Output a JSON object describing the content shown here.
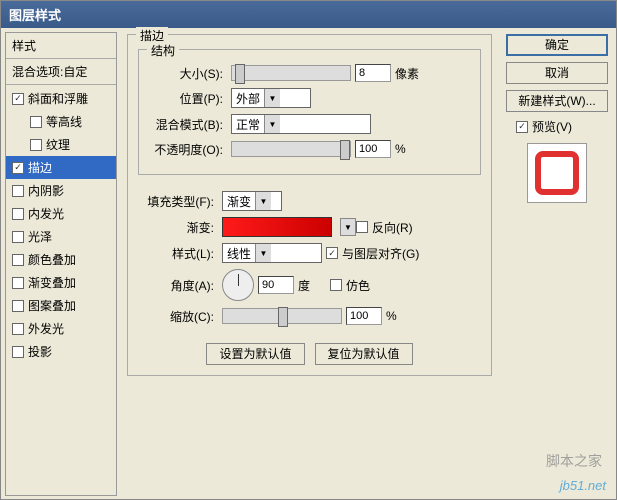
{
  "dialog": {
    "title": "图层样式"
  },
  "sidebar": {
    "header": "样式",
    "blendOptions": "混合选项:自定",
    "items": [
      {
        "label": "斜面和浮雕",
        "checked": true,
        "indent": false
      },
      {
        "label": "等高线",
        "checked": false,
        "indent": true
      },
      {
        "label": "纹理",
        "checked": false,
        "indent": true
      },
      {
        "label": "描边",
        "checked": true,
        "indent": false,
        "active": true
      },
      {
        "label": "内阴影",
        "checked": false,
        "indent": false
      },
      {
        "label": "内发光",
        "checked": false,
        "indent": false
      },
      {
        "label": "光泽",
        "checked": false,
        "indent": false
      },
      {
        "label": "颜色叠加",
        "checked": false,
        "indent": false
      },
      {
        "label": "渐变叠加",
        "checked": false,
        "indent": false
      },
      {
        "label": "图案叠加",
        "checked": false,
        "indent": false
      },
      {
        "label": "外发光",
        "checked": false,
        "indent": false
      },
      {
        "label": "投影",
        "checked": false,
        "indent": false
      }
    ]
  },
  "main": {
    "panelTitle": "描边",
    "structure": {
      "legend": "结构",
      "sizeLabel": "大小(S):",
      "sizeValue": "8",
      "sizeUnit": "像素",
      "positionLabel": "位置(P):",
      "positionValue": "外部",
      "blendModeLabel": "混合模式(B):",
      "blendModeValue": "正常",
      "opacityLabel": "不透明度(O):",
      "opacityValue": "100",
      "opacityUnit": "%"
    },
    "fill": {
      "fillTypeLabel": "填充类型(F):",
      "fillTypeValue": "渐变",
      "gradientLabel": "渐变:",
      "reverseLabel": "反向(R)",
      "styleLabel": "样式(L):",
      "styleValue": "线性",
      "alignLabel": "与图层对齐(G)",
      "angleLabel": "角度(A):",
      "angleValue": "90",
      "angleUnit": "度",
      "ditherLabel": "仿色",
      "scaleLabel": "缩放(C):",
      "scaleValue": "100",
      "scaleUnit": "%"
    },
    "buttons": {
      "setDefault": "设置为默认值",
      "resetDefault": "复位为默认值"
    }
  },
  "right": {
    "ok": "确定",
    "cancel": "取消",
    "newStyle": "新建样式(W)...",
    "previewLabel": "预览(V)"
  },
  "watermark": {
    "cn": "脚本之家",
    "en": "jb51.net"
  }
}
